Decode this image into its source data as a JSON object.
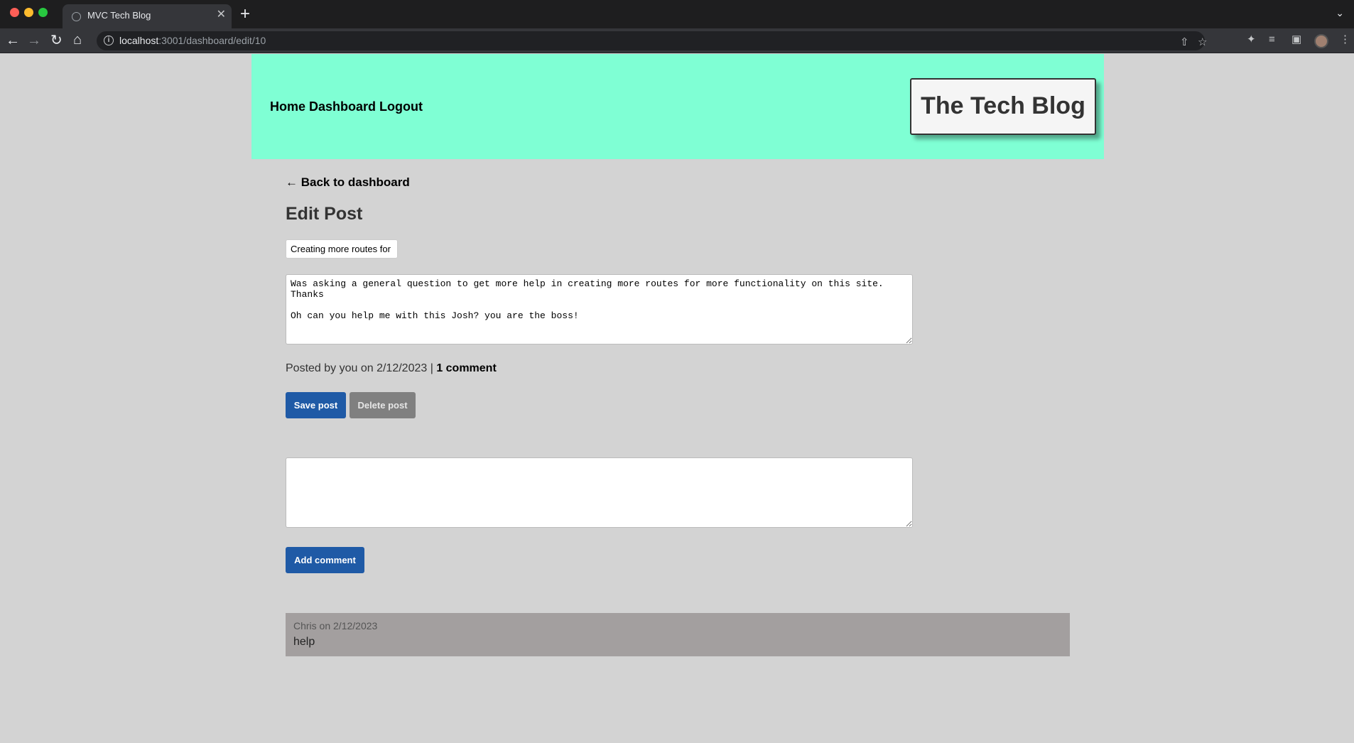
{
  "browser": {
    "tab_title": "MVC Tech Blog",
    "tab_close": "✕",
    "new_tab": "+",
    "url_host": "localhost",
    "url_path": ":3001/dashboard/edit/10"
  },
  "header": {
    "nav": [
      "Home",
      "Dashboard",
      "Logout"
    ],
    "brand": "The Tech Blog",
    "background": "#7fffd4"
  },
  "main": {
    "back_link": "← Back to dashboard",
    "heading": "Edit Post",
    "post_title_value": "Creating more routes for",
    "post_body_value": "Was asking a general question to get more help in creating more routes for more functionality on this site. Thanks\n\nOh can you help me with this Josh? you are the boss!",
    "meta_prefix": "Posted by you on 2/12/2023 | ",
    "meta_comments": "1 comment",
    "save_label": "Save post",
    "delete_label": "Delete post",
    "comment_placeholder": "",
    "add_comment_label": "Add comment"
  },
  "comments": [
    {
      "meta": "Chris on 2/12/2023",
      "text": "help"
    }
  ],
  "colors": {
    "page_bg": "#d3d3d3",
    "primary_button": "#1f5aa6",
    "delete_button": "#808080",
    "comment_bg": "#a39f9f"
  }
}
